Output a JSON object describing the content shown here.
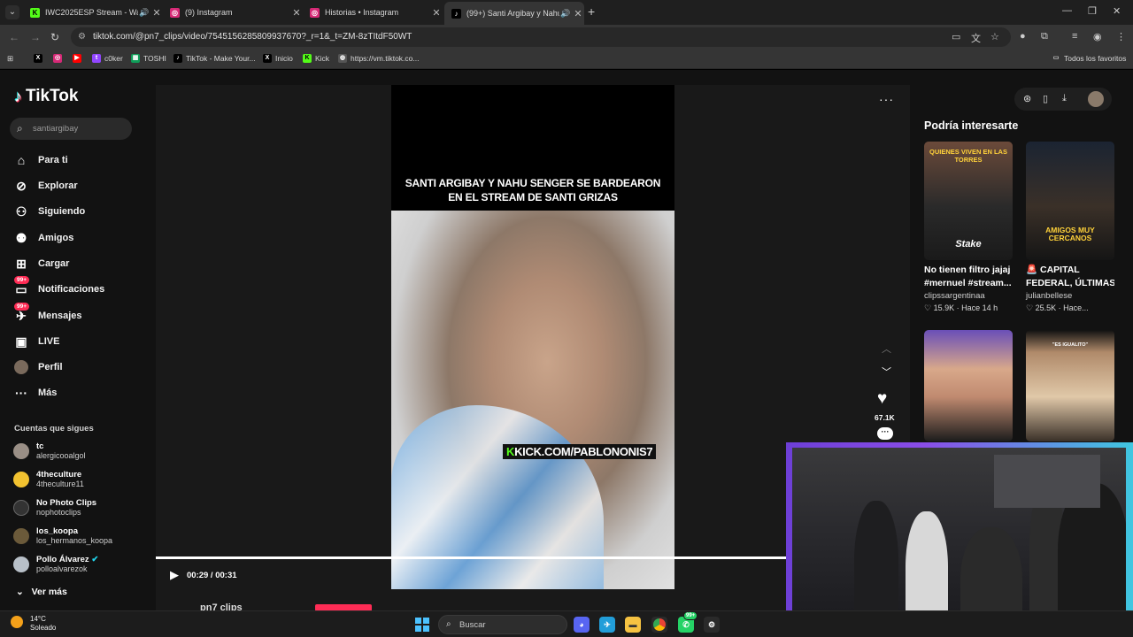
{
  "browser": {
    "tabs": [
      {
        "title": "IWC2025ESP Stream - Wat...",
        "favicon": "kick-icon",
        "color": "#53fc18",
        "sound": true
      },
      {
        "title": "(9) Instagram",
        "favicon": "instagram-icon",
        "color": "#d62976",
        "sound": false
      },
      {
        "title": "Historias • Instagram",
        "favicon": "instagram-icon",
        "color": "#d62976",
        "sound": false
      },
      {
        "title": "(99+) Santi Argibay y Nahu...",
        "favicon": "tiktok-icon",
        "color": "#000000",
        "sound": true,
        "active": true
      }
    ],
    "url": "tiktok.com/@pn7_clips/video/7545156285809937670?_r=1&_t=ZM-8zTItdF50WT",
    "bookmarks": [
      {
        "label": "",
        "icon": "x-icon",
        "color": "#000000"
      },
      {
        "label": "",
        "icon": "instagram-icon",
        "color": "#d62976"
      },
      {
        "label": "",
        "icon": "youtube-icon",
        "color": "#ff0000"
      },
      {
        "label": "c0ker",
        "icon": "twitch-icon",
        "color": "#9146ff"
      },
      {
        "label": "TOSHI",
        "icon": "sheet-icon",
        "color": "#0f9d58"
      },
      {
        "label": "TikTok - Make Your...",
        "icon": "tiktok-icon",
        "color": "#000000"
      },
      {
        "label": "Inicio",
        "icon": "x-icon",
        "color": "#000000"
      },
      {
        "label": "Kick",
        "icon": "kick-icon",
        "color": "#53fc18"
      },
      {
        "label": "https://vm.tiktok.co...",
        "icon": "globe-icon",
        "color": "#555555"
      }
    ],
    "all_favorites": "Todos los favoritos"
  },
  "tiktok": {
    "logo": "TikTok",
    "search_value": "santiargibay",
    "nav": [
      {
        "label": "Para ti",
        "icon": "home-icon"
      },
      {
        "label": "Explorar",
        "icon": "compass-icon"
      },
      {
        "label": "Siguiendo",
        "icon": "following-icon"
      },
      {
        "label": "Amigos",
        "icon": "friends-icon"
      },
      {
        "label": "Cargar",
        "icon": "upload-icon"
      },
      {
        "label": "Notificaciones",
        "icon": "inbox-icon",
        "badge": "99+"
      },
      {
        "label": "Mensajes",
        "icon": "messages-icon",
        "badge": "99+"
      },
      {
        "label": "LIVE",
        "icon": "live-icon"
      },
      {
        "label": "Perfil",
        "icon": "profile-avatar"
      },
      {
        "label": "Más",
        "icon": "more-icon"
      }
    ],
    "following_title": "Cuentas que sigues",
    "following": [
      {
        "name": "tc",
        "handle": "alergicooalgol",
        "color": "#9a8f86"
      },
      {
        "name": "4theculture",
        "handle": "4theculture11",
        "color": "#f2c230"
      },
      {
        "name": "No Photo Clips",
        "handle": "nophotoclips",
        "color": "#333333"
      },
      {
        "name": "los_koopa",
        "handle": "los_hermanos_koopa",
        "color": "#6b5a3a"
      },
      {
        "name": "Pollo Álvarez",
        "handle": "polloalvarezok",
        "color": "#b8c0c8",
        "verified": true
      }
    ],
    "see_more": "Ver más",
    "video": {
      "caption_line1": "SANTI ARGIBAY Y NAHU SENGER SE BARDEARON",
      "caption_line2": "EN EL STREAM DE SANTI GRIZAS",
      "watermark": "KICK.COM/PABLONONIS7",
      "time": "00:29 / 00:31",
      "progress": 0.94,
      "author": "pn7 clips",
      "likes": "67.1K"
    },
    "suggest_title": "Podría interesarte",
    "suggestions": [
      {
        "title": "No tienen filtro jajaj",
        "title2": "#mernuel #stream...",
        "user": "clipssargentinaa",
        "likes": "15.9K",
        "when": "Hace 14 h",
        "thumb_text": "QUIENES VIVEN EN LAS TORRES",
        "thumb_text2": "Stake"
      },
      {
        "title": "🚨 CAPITAL",
        "title2": "FEDERAL, ÚLTIMAS...",
        "user": "julianbellese",
        "likes": "25.5K",
        "when": "Hace...",
        "thumb_text": "AMIGOS MUY CERCANOS",
        "thumb_text2": ""
      },
      {
        "title": "",
        "title2": "",
        "user": "",
        "likes": "",
        "when": "",
        "thumb_text": "",
        "thumb_text2": ""
      },
      {
        "title": "",
        "title2": "",
        "user": "",
        "likes": "",
        "when": "",
        "thumb_text": "\"ES IGUALITO\"",
        "thumb_text2": ""
      }
    ]
  },
  "taskbar": {
    "temp": "14°C",
    "weather": "Soleado",
    "search": "Buscar",
    "whatsapp_badge": "99+"
  }
}
